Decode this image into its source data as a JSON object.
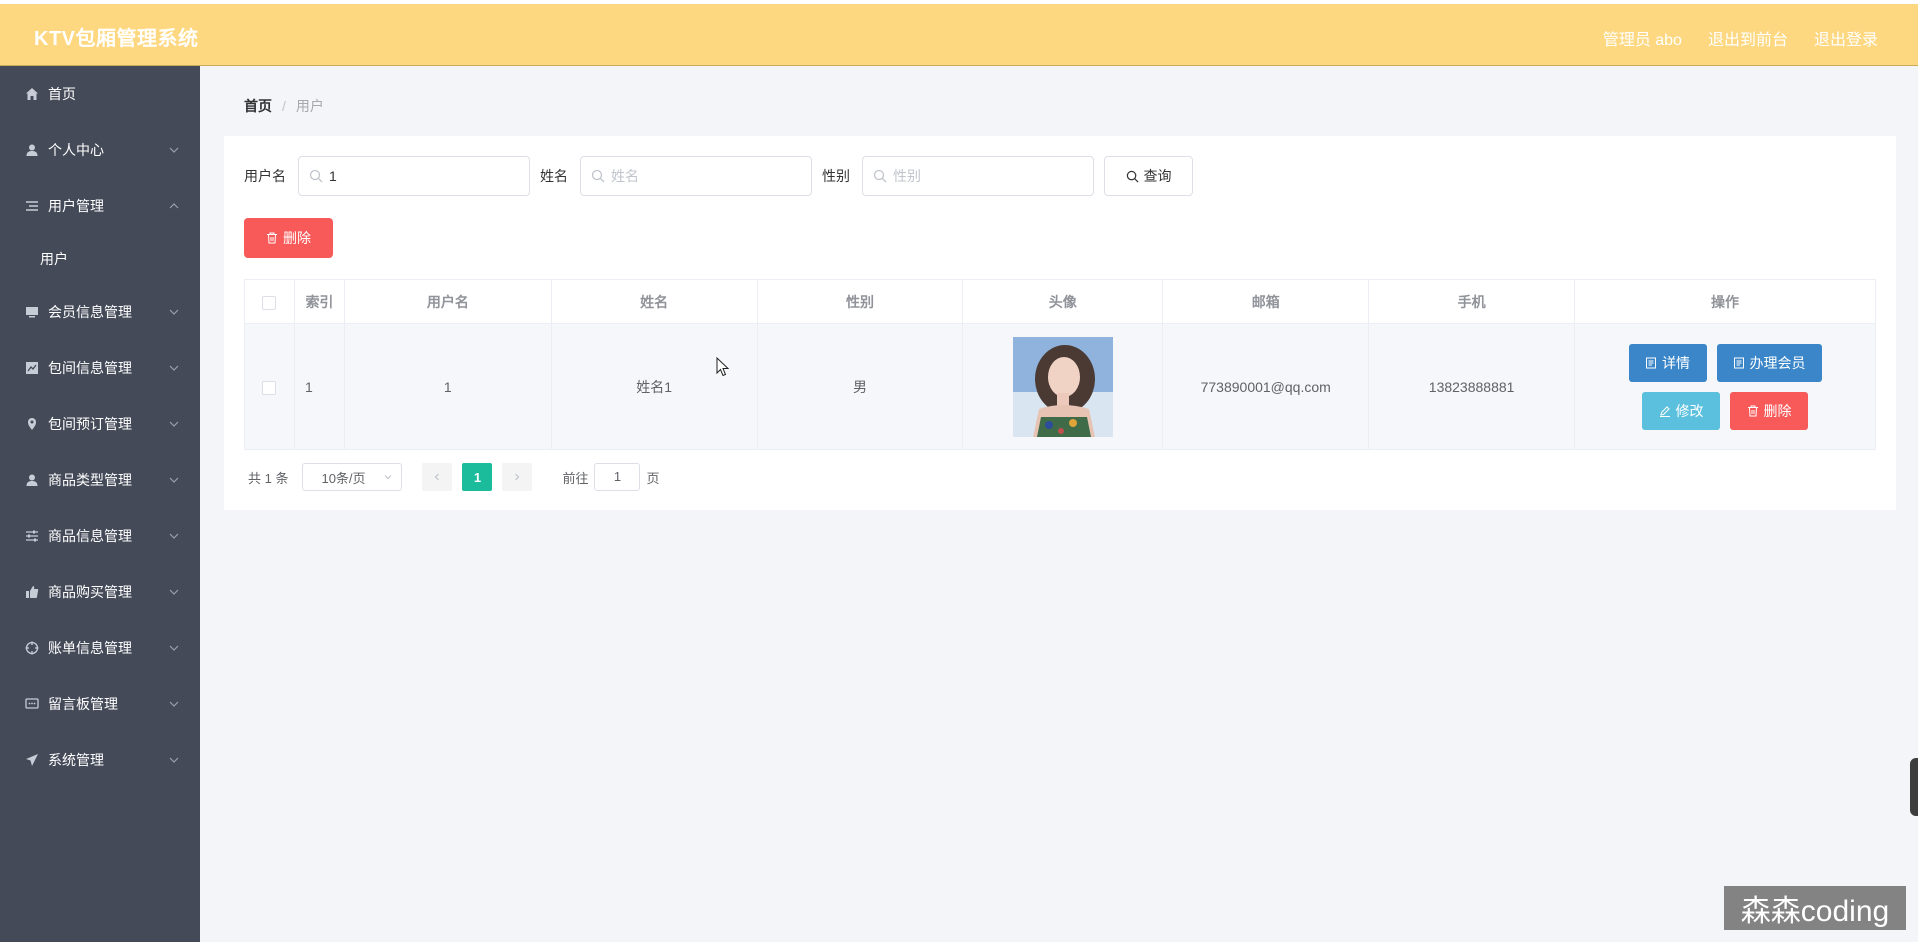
{
  "header": {
    "title": "KTV包厢管理系统",
    "nav": [
      "管理员 abo",
      "退出到前台",
      "退出登录"
    ]
  },
  "sidebar": {
    "items": [
      {
        "label": "首页",
        "icon": "home-icon",
        "expandable": false
      },
      {
        "label": "个人中心",
        "icon": "user-icon",
        "expandable": true
      },
      {
        "label": "用户管理",
        "icon": "list-icon",
        "expandable": true,
        "expanded": true,
        "children": [
          "用户"
        ]
      },
      {
        "label": "会员信息管理",
        "icon": "monitor-icon",
        "expandable": true
      },
      {
        "label": "包间信息管理",
        "icon": "chart-icon",
        "expandable": true
      },
      {
        "label": "包间预订管理",
        "icon": "location-icon",
        "expandable": true
      },
      {
        "label": "商品类型管理",
        "icon": "user-icon",
        "expandable": true
      },
      {
        "label": "商品信息管理",
        "icon": "sliders-icon",
        "expandable": true
      },
      {
        "label": "商品购买管理",
        "icon": "thumb-icon",
        "expandable": true
      },
      {
        "label": "账单信息管理",
        "icon": "crosshair-icon",
        "expandable": true
      },
      {
        "label": "留言板管理",
        "icon": "chat-icon",
        "expandable": true
      },
      {
        "label": "系统管理",
        "icon": "send-icon",
        "expandable": true
      }
    ]
  },
  "breadcrumb": {
    "home": "首页",
    "separator": "/",
    "current": "用户"
  },
  "search": {
    "username": {
      "label": "用户名",
      "value": "1",
      "placeholder": "用户名"
    },
    "name": {
      "label": "姓名",
      "value": "",
      "placeholder": "姓名"
    },
    "gender": {
      "label": "性别",
      "value": "",
      "placeholder": "性别"
    },
    "query_label": "查询"
  },
  "toolbar": {
    "delete_label": "删除"
  },
  "table": {
    "columns": [
      "索引",
      "用户名",
      "姓名",
      "性别",
      "头像",
      "邮箱",
      "手机",
      "操作"
    ],
    "rows": [
      {
        "index": "1",
        "username": "1",
        "name": "姓名1",
        "gender": "男",
        "email": "773890001@qq.com",
        "phone": "13823888881"
      }
    ],
    "actions": {
      "detail": "详情",
      "member": "办理会员",
      "edit": "修改",
      "delete": "删除"
    }
  },
  "pagination": {
    "total_text": "共 1 条",
    "page_size": "10条/页",
    "current_page": "1",
    "goto_label": "前往",
    "goto_value": "1",
    "page_suffix": "页"
  },
  "watermark": "森森coding",
  "colors": {
    "header": "#fed880",
    "sidebar": "#444a58",
    "danger": "#f85a5a",
    "primary": "#3a86c9",
    "info": "#5bc0de",
    "pager_active": "#1bbc9b"
  }
}
